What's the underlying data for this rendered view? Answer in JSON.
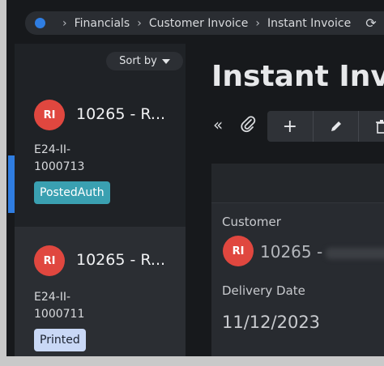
{
  "breadcrumb": {
    "items": [
      "Financials",
      "Customer Invoice",
      "Instant Invoice"
    ]
  },
  "list": {
    "sort_label": "Sort by",
    "items": [
      {
        "avatar": "RI",
        "title": "10265 - R...",
        "id": "E24-II-1000713",
        "status": "PostedAuth",
        "status_color": "#3aa0b1"
      },
      {
        "avatar": "RI",
        "title": "10265 - R...",
        "id": "E24-II-1000711",
        "status": "Printed",
        "status_color": "#c9d8f6"
      }
    ]
  },
  "page": {
    "title": "Instant Invo"
  },
  "details": {
    "customer_label": "Customer",
    "customer_avatar": "RI",
    "customer_value": "10265 -",
    "delivery_label": "Delivery Date",
    "delivery_value": "11/12/2023"
  },
  "colors": {
    "accent": "#2f7de1",
    "avatar": "#e0473f",
    "background": "#17191c"
  }
}
